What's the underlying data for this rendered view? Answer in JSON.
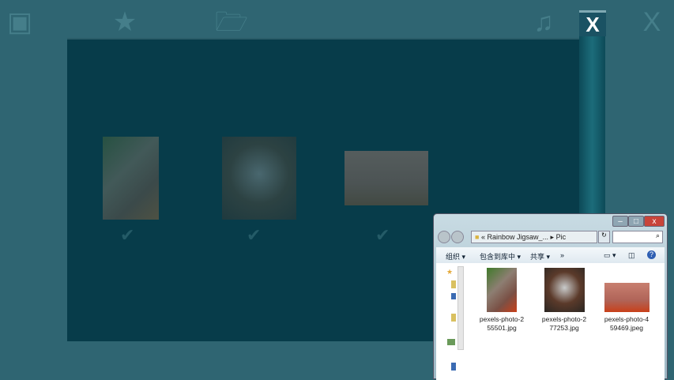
{
  "toolbar": {
    "icons": [
      "image-frame-icon",
      "star-icon",
      "folder-icon",
      "music-icon",
      "close-icon"
    ],
    "close_label": "X",
    "ghost_close_label": "X"
  },
  "gallery": {
    "items": [
      {
        "name": "pexels-photo-255501.jpg",
        "selected": true
      },
      {
        "name": "pexels-photo-277253.jpg",
        "selected": true
      },
      {
        "name": "pexels-photo-459469.jpeg",
        "selected": true
      }
    ],
    "check_glyph": "✔"
  },
  "explorer": {
    "window_buttons": {
      "minimize": "–",
      "maximize": "□",
      "close": "x"
    },
    "address": {
      "prefix": "«",
      "path1": "Rainbow Jigsaw_...",
      "sep": "▸",
      "path2": "Pic"
    },
    "search_icon": "⌕",
    "toolbar": {
      "organize": "组织 ▾",
      "include": "包含到库中 ▾",
      "share": "共享 ▾",
      "more": "»",
      "help": "?"
    },
    "files": [
      {
        "name_line1": "pexels-photo-2",
        "name_line2": "55501.jpg"
      },
      {
        "name_line1": "pexels-photo-2",
        "name_line2": "77253.jpg"
      },
      {
        "name_line1": "pexels-photo-4",
        "name_line2": "59469.jpeg"
      }
    ]
  }
}
